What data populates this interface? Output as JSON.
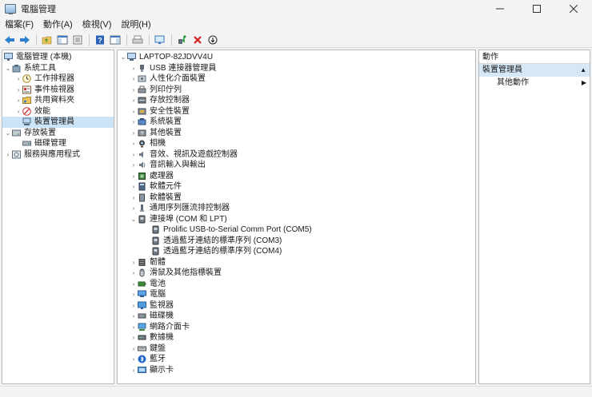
{
  "window": {
    "title": "電腦管理"
  },
  "menu": [
    "檔案(F)",
    "動作(A)",
    "檢視(V)",
    "說明(H)"
  ],
  "left_tree": {
    "root": "電腦管理 (本機)",
    "system_tools": "系統工具",
    "task_scheduler": "工作排程器",
    "event_viewer": "事件檢視器",
    "shared_folders": "共用資料夾",
    "performance": "效能",
    "device_manager": "裝置管理員",
    "storage": "存放裝置",
    "disk_management": "磁碟管理",
    "services_apps": "服務與應用程式"
  },
  "device_tree": {
    "root": "LAPTOP-82JDVV4U",
    "categories": [
      {
        "label": "USB 連接器管理員",
        "icon": "usb-connector-icon"
      },
      {
        "label": "人性化介面裝置",
        "icon": "hid-icon"
      },
      {
        "label": "列印佇列",
        "icon": "printer-icon"
      },
      {
        "label": "存放控制器",
        "icon": "storage-controller-icon"
      },
      {
        "label": "安全性裝置",
        "icon": "security-device-icon"
      },
      {
        "label": "系統裝置",
        "icon": "system-device-icon"
      },
      {
        "label": "其他裝置",
        "icon": "other-device-icon"
      },
      {
        "label": "相機",
        "icon": "camera-icon"
      },
      {
        "label": "音效、視訊及遊戲控制器",
        "icon": "speaker-icon"
      },
      {
        "label": "音訊輸入與輸出",
        "icon": "audio-io-icon"
      },
      {
        "label": "處理器",
        "icon": "processor-icon"
      },
      {
        "label": "軟體元件",
        "icon": "software-component-icon"
      },
      {
        "label": "軟體裝置",
        "icon": "software-device-icon"
      },
      {
        "label": "通用序列匯流排控制器",
        "icon": "usb-controller-icon"
      },
      {
        "label": "連接埠 (COM 和 LPT)",
        "icon": "port-icon"
      }
    ],
    "ports": [
      "Prolific USB-to-Serial Comm Port (COM5)",
      "透過藍牙連結的標準序列 (COM3)",
      "透過藍牙連結的標準序列 (COM4)"
    ],
    "categories_after": [
      {
        "label": "韌體",
        "icon": "firmware-icon"
      },
      {
        "label": "滑鼠及其他指標裝置",
        "icon": "mouse-icon"
      },
      {
        "label": "電池",
        "icon": "battery-icon"
      },
      {
        "label": "電腦",
        "icon": "computer-icon"
      },
      {
        "label": "監視器",
        "icon": "monitor-icon"
      },
      {
        "label": "磁碟機",
        "icon": "disk-drive-icon"
      },
      {
        "label": "網路介面卡",
        "icon": "network-adapter-icon"
      },
      {
        "label": "數據機",
        "icon": "modem-icon"
      },
      {
        "label": "鍵盤",
        "icon": "keyboard-icon"
      },
      {
        "label": "藍牙",
        "icon": "bluetooth-icon"
      },
      {
        "label": "顯示卡",
        "icon": "display-adapter-icon"
      }
    ]
  },
  "actions": {
    "header": "動作",
    "section": "裝置管理員",
    "more": "其他動作"
  }
}
